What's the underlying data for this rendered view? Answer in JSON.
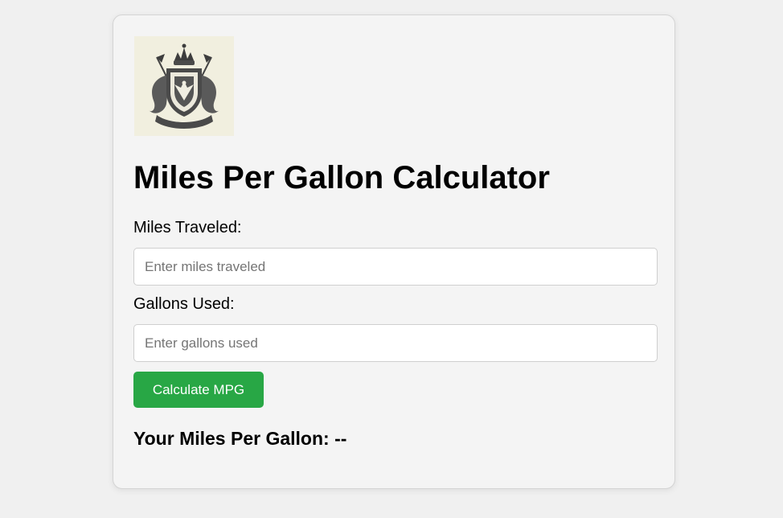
{
  "calculator": {
    "logo_icon": "coat-of-arms-crest",
    "title": "Miles Per Gallon Calculator",
    "miles_label": "Miles Traveled:",
    "miles_placeholder": "Enter miles traveled",
    "miles_value": "",
    "gallons_label": "Gallons Used:",
    "gallons_placeholder": "Enter gallons used",
    "gallons_value": "",
    "button_label": "Calculate MPG",
    "result_label": "Your Miles Per Gallon:",
    "result_value": "--"
  },
  "colors": {
    "page_background": "#f0f0f0",
    "card_background": "#f4f4f4",
    "button": "#28a745",
    "button_text": "#ffffff"
  }
}
